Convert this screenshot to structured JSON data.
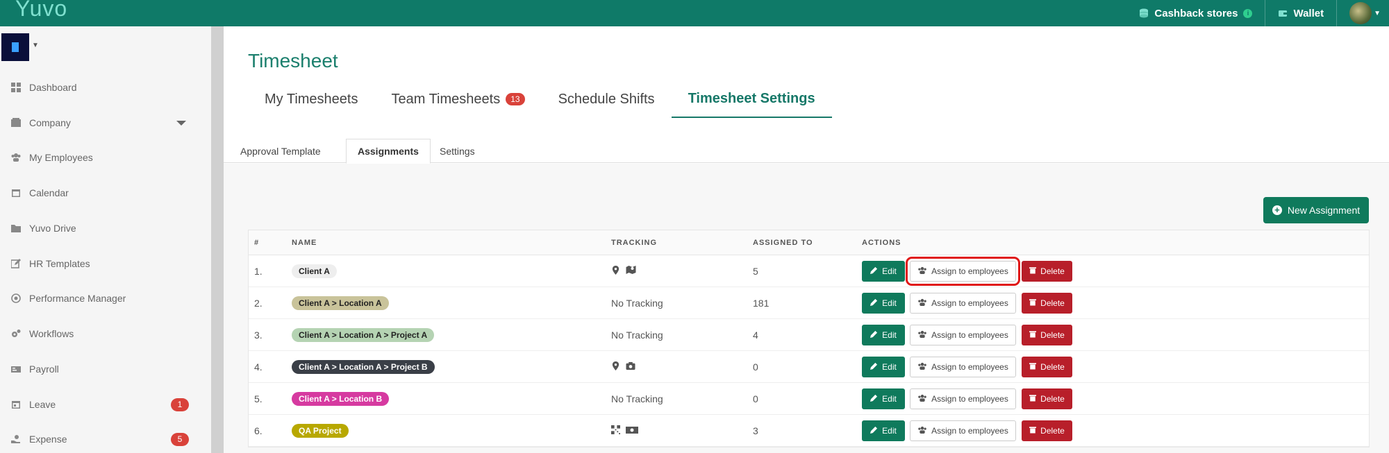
{
  "app": {
    "logo": "Yuvo",
    "cashback_label": "Cashback stores",
    "info_icon": "i",
    "wallet_label": "Wallet",
    "accent": "#0f7a68"
  },
  "sidebar": {
    "items": [
      {
        "label": "Dashboard",
        "icon": "grid-icon"
      },
      {
        "label": "Company",
        "icon": "building-icon"
      },
      {
        "label": "My Employees",
        "icon": "users-icon"
      },
      {
        "label": "Calendar",
        "icon": "calendar-icon"
      },
      {
        "label": "Yuvo Drive",
        "icon": "folder-icon"
      },
      {
        "label": "HR Templates",
        "icon": "edit-icon"
      },
      {
        "label": "Performance Manager",
        "icon": "target-icon"
      },
      {
        "label": "Workflows",
        "icon": "cogs-icon"
      },
      {
        "label": "Payroll",
        "icon": "money-icon"
      },
      {
        "label": "Leave",
        "icon": "calendar-icon",
        "badge": "1"
      },
      {
        "label": "Expense",
        "icon": "hand-icon",
        "badge": "5"
      }
    ]
  },
  "page": {
    "title": "Timesheet",
    "tabs": [
      {
        "label": "My Timesheets"
      },
      {
        "label": "Team Timesheets",
        "badge": "13"
      },
      {
        "label": "Schedule Shifts"
      },
      {
        "label": "Timesheet Settings"
      }
    ],
    "subtabs": [
      "Approval Template",
      "Assignments",
      "Settings"
    ],
    "new_button": "New Assignment",
    "plus": "+"
  },
  "table": {
    "headers": {
      "num": "#",
      "name": "NAME",
      "tracking": "TRACKING",
      "assigned": "ASSIGNED TO",
      "actions": "ACTIONS"
    },
    "actions": {
      "edit": "Edit",
      "assign": "Assign to employees",
      "delete": "Delete"
    },
    "rows": [
      {
        "num": "1.",
        "name": "Client A",
        "pill_bg": "#eeeeee",
        "pill_fg": "#222222",
        "tracking": "",
        "tracking_icons": [
          "map-marker-icon",
          "map-icon"
        ],
        "assigned": "5"
      },
      {
        "num": "2.",
        "name": "Client A > Location A",
        "pill_bg": "#c9c39a",
        "pill_fg": "#222222",
        "tracking": "No Tracking",
        "tracking_icons": [],
        "assigned": "181"
      },
      {
        "num": "3.",
        "name": "Client A > Location A > Project A",
        "pill_bg": "#b5d3b3",
        "pill_fg": "#222222",
        "tracking": "No Tracking",
        "tracking_icons": [],
        "assigned": "4"
      },
      {
        "num": "4.",
        "name": "Client A > Location A > Project B",
        "pill_bg": "#3a3f47",
        "pill_fg": "#ffffff",
        "tracking": "",
        "tracking_icons": [
          "map-marker-icon",
          "camera-icon"
        ],
        "assigned": "0"
      },
      {
        "num": "5.",
        "name": "Client A > Location B",
        "pill_bg": "#d63aa0",
        "pill_fg": "#ffffff",
        "tracking": "No Tracking",
        "tracking_icons": [],
        "assigned": "0"
      },
      {
        "num": "6.",
        "name": "QA Project",
        "pill_bg": "#b8a800",
        "pill_fg": "#ffffff",
        "tracking": "",
        "tracking_icons": [
          "qrcode-icon",
          "money-icon"
        ],
        "assigned": "3"
      }
    ]
  }
}
